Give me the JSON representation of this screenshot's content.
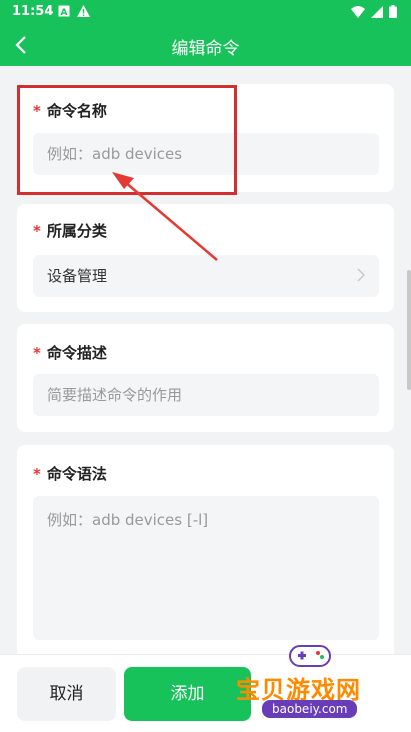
{
  "status_bar": {
    "time": "11:54"
  },
  "header": {
    "title": "编辑命令"
  },
  "form": {
    "required_mark": "*",
    "name": {
      "label": "命令名称",
      "placeholder": "例如：adb devices"
    },
    "category": {
      "label": "所属分类",
      "value": "设备管理"
    },
    "description": {
      "label": "命令描述",
      "placeholder": "简要描述命令的作用"
    },
    "syntax": {
      "label": "命令语法",
      "placeholder": "例如：adb devices [-l]"
    }
  },
  "actions": {
    "cancel_label": "取消",
    "add_label": "添加"
  },
  "watermark": {
    "brand": "宝贝游戏网",
    "site": "baobeiy.com"
  },
  "colors": {
    "accent": "#18c25a",
    "required": "#e53935",
    "annotation": "#d32f2f"
  },
  "icons": [
    "back-arrow-icon",
    "chevron-right-icon",
    "wifi-icon",
    "battery-icon",
    "signal-icon"
  ]
}
